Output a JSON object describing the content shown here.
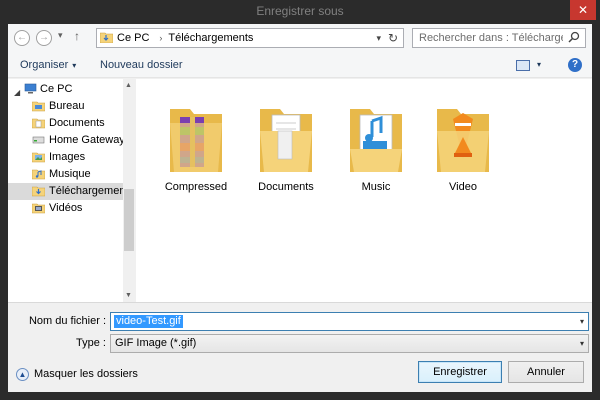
{
  "window": {
    "title": "Enregistrer sous",
    "close_glyph": "✕"
  },
  "nav": {
    "back_glyph": "←",
    "forward_glyph": "→",
    "recent_glyph": "▾",
    "up_glyph": "↑"
  },
  "address": {
    "segments": [
      "Ce PC",
      "Téléchargements"
    ],
    "separator": "›",
    "dropdown_glyph": "▾",
    "refresh_glyph": "↻"
  },
  "search": {
    "placeholder": "Rechercher dans : Télécharge..."
  },
  "toolbar": {
    "organize_label": "Organiser",
    "new_folder_label": "Nouveau dossier",
    "caret": "▾",
    "help_glyph": "?"
  },
  "tree": {
    "root_label": "Ce PC",
    "expander": "◢",
    "items": [
      {
        "label": "Bureau",
        "icon": "desktop-folder-icon"
      },
      {
        "label": "Documents",
        "icon": "documents-folder-icon"
      },
      {
        "label": "Home Gateway N",
        "icon": "network-drive-icon"
      },
      {
        "label": "Images",
        "icon": "pictures-folder-icon"
      },
      {
        "label": "Musique",
        "icon": "music-folder-icon"
      },
      {
        "label": "Téléchargements",
        "icon": "downloads-folder-icon",
        "selected": true
      },
      {
        "label": "Vidéos",
        "icon": "videos-folder-icon"
      }
    ]
  },
  "scroll": {
    "up": "▲",
    "down": "▼"
  },
  "folders": [
    {
      "label": "Compressed",
      "icon": "compressed-folder-icon"
    },
    {
      "label": "Documents",
      "icon": "documents-folder-icon"
    },
    {
      "label": "Music",
      "icon": "music-folder-icon"
    },
    {
      "label": "Video",
      "icon": "video-folder-icon"
    }
  ],
  "form": {
    "filename_label": "Nom du fichier :",
    "filename_value": "video-Test.gif",
    "type_label": "Type :",
    "type_value": "GIF Image (*.gif)",
    "dropdown_glyph": "▾",
    "hide_folders_label": "Masquer les dossiers",
    "hide_folders_glyph": "▲",
    "save_label": "Enregistrer",
    "cancel_label": "Annuler"
  },
  "colors": {
    "folder": "#f5d37a",
    "folder_dark": "#e8b94a",
    "accent": "#3399ff",
    "close": "#c7372f"
  }
}
